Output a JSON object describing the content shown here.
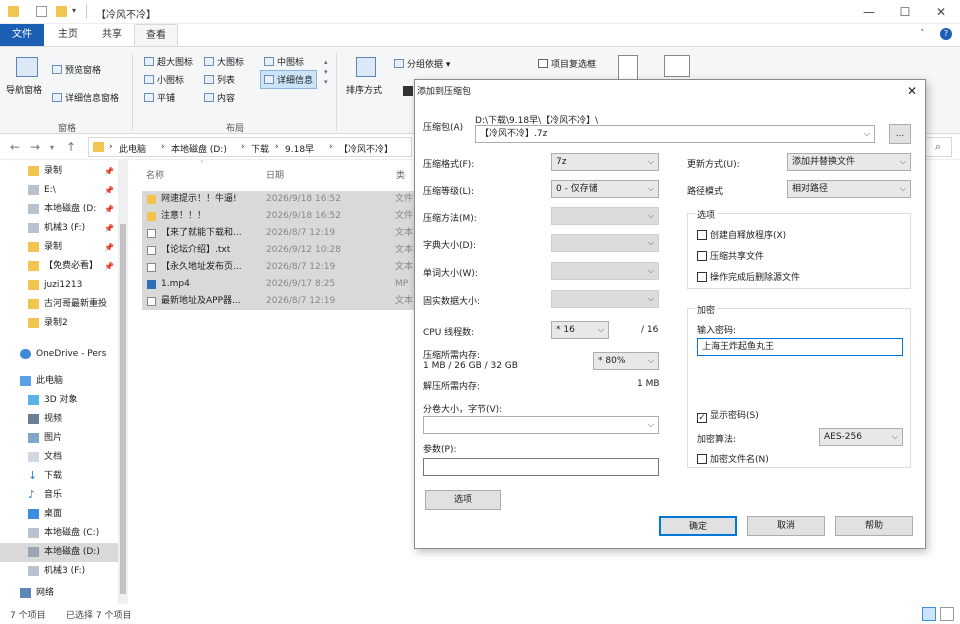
{
  "window": {
    "title": "【冷风不冷】"
  },
  "ribbon_tabs": [
    "文件",
    "主页",
    "共享",
    "查看"
  ],
  "ribbon": {
    "pane_group": {
      "nav_pane": "导航窗格",
      "preview": "预览窗格",
      "details": "详细信息窗格",
      "label": "窗格"
    },
    "layout_group": {
      "items": [
        "超大图标",
        "大图标",
        "中图标",
        "小图标",
        "列表",
        "详细信息",
        "平铺",
        "内容"
      ],
      "label": "布局"
    },
    "view_group": {
      "sort": "排序方式",
      "group_by": "分组依据",
      "item_checkbox": "项目复选框"
    }
  },
  "address": {
    "crumbs": [
      "此电脑",
      "本地磁盘 (D:)",
      "下载",
      "9.18早",
      "【冷风不冷】"
    ]
  },
  "sidebar": {
    "items": [
      "录制",
      "E:\\",
      "本地磁盘 (D:",
      "机械3 (F:)",
      "录制",
      "【免费必看】",
      "juzi1213",
      "古河哥最新重投",
      "录制2",
      "OneDrive - Pers",
      "此电脑",
      "3D 对象",
      "视频",
      "图片",
      "文档",
      "下载",
      "音乐",
      "桌面",
      "本地磁盘 (C:)",
      "本地磁盘 (D:)",
      "机械3 (F:)",
      "网络"
    ]
  },
  "files": {
    "columns": [
      "名称",
      "日期",
      "类"
    ],
    "rows": [
      {
        "name": "网速提示！！牛逼!",
        "date": "2026/9/18 16:52",
        "type": "文件"
      },
      {
        "name": "注意！！！",
        "date": "2026/9/18 16:52",
        "type": "文件"
      },
      {
        "name": "【来了就能下载和...",
        "date": "2026/8/7 12:19",
        "type": "文本"
      },
      {
        "name": "【论坛介绍】.txt",
        "date": "2026/9/12 10:28",
        "type": "文本"
      },
      {
        "name": "【永久地址发布页...",
        "date": "2026/8/7 12:19",
        "type": "文本"
      },
      {
        "name": "1.mp4",
        "date": "2026/9/17 8:25",
        "type": "MP"
      },
      {
        "name": "最新地址及APP器...",
        "date": "2026/8/7 12:19",
        "type": "文本"
      }
    ]
  },
  "status": {
    "count": "7 个项目",
    "selected": "已选择 7 个项目"
  },
  "dialog": {
    "title": "添加到压缩包",
    "archive_label": "压缩包(A)",
    "archive_path": "D:\\下载\\9.18早\\【冷风不冷】\\",
    "archive_name": "【冷风不冷】.7z",
    "browse": "...",
    "format_label": "压缩格式(F):",
    "format_value": "7z",
    "level_label": "压缩等级(L):",
    "level_value": "0 - 仅存储",
    "method_label": "压缩方法(M):",
    "dict_label": "字典大小(D):",
    "word_label": "单词大小(W):",
    "solid_label": "固实数据大小:",
    "cpu_label": "CPU 线程数:",
    "cpu_value": "* 16",
    "cpu_total": "/ 16",
    "mem_label": "压缩所需内存:",
    "mem_detail": "1 MB / 26 GB / 32 GB",
    "mem_value": "* 80%",
    "demem_label": "解压所需内存:",
    "demem_value": "1 MB",
    "split_label": "分卷大小，字节(V):",
    "params_label": "参数(P):",
    "options_button": "选项",
    "update_label": "更新方式(U):",
    "update_value": "添加并替换文件",
    "path_label": "路径模式",
    "path_value": "相对路径",
    "options_group": "选项",
    "opt_sfx": "创建自释放程序(X)",
    "opt_shared": "压缩共享文件",
    "opt_delete": "操作完成后删除源文件",
    "encrypt_group": "加密",
    "password_label": "输入密码:",
    "password_value": "上海王炸起鱼丸王",
    "show_password": "显示密码(S)",
    "enc_method_label": "加密算法:",
    "enc_method_value": "AES-256",
    "encrypt_names": "加密文件名(N)",
    "ok": "确定",
    "cancel": "取消",
    "help": "帮助",
    "close_icon": "✕"
  }
}
